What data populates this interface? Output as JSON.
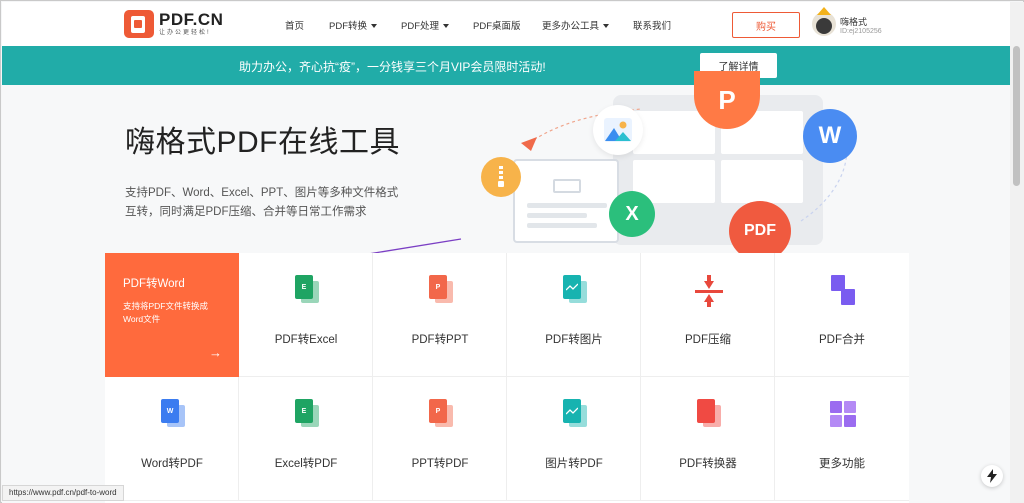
{
  "header": {
    "logo_name": "PDF.CN",
    "logo_slogan": "让办公更轻松!",
    "nav": [
      {
        "label": "首页"
      },
      {
        "label": "PDF转换"
      },
      {
        "label": "PDF处理"
      },
      {
        "label": "PDF桌面版"
      },
      {
        "label": "更多办公工具"
      },
      {
        "label": "联系我们"
      }
    ],
    "buy_label": "购买",
    "user_name": "嗨格式",
    "user_id": "ID:ej2105256"
  },
  "banner": {
    "text": "助力办公，齐心抗“疫”，一分钱享三个月VIP会员限时活动!",
    "button": "了解详情"
  },
  "hero": {
    "title": "嗨格式PDF在线工具",
    "desc_line1": "支持PDF、Word、Excel、PPT、图片等多种文件格式",
    "desc_line2": "互转，同时满足PDF压缩、合并等日常工作需求",
    "badges": {
      "p": "P",
      "w": "W",
      "x": "X",
      "pdf": "PDF"
    }
  },
  "tools": {
    "featured": {
      "title": "PDF转Word",
      "desc": "支持将PDF文件转换成Word文件",
      "arrow": "→"
    },
    "row1": [
      {
        "label": "PDF转Excel",
        "icon": "excel-doc-icon",
        "color": "#1fa463",
        "glyph": "E"
      },
      {
        "label": "PDF转PPT",
        "icon": "ppt-doc-icon",
        "color": "#f2674a",
        "glyph": "P"
      },
      {
        "label": "PDF转图片",
        "icon": "image-doc-icon",
        "color": "#17b3b0",
        "glyph": ""
      },
      {
        "label": "PDF压缩",
        "icon": "compress-icon",
        "color": "#e8483c",
        "glyph": ""
      },
      {
        "label": "PDF合并",
        "icon": "merge-icon",
        "color": "#7a5cf0",
        "glyph": ""
      }
    ],
    "row2": [
      {
        "label": "Word转PDF",
        "icon": "word-doc-icon",
        "color": "#3b7cf0",
        "glyph": "W"
      },
      {
        "label": "Excel转PDF",
        "icon": "excel-doc-icon",
        "color": "#1fa463",
        "glyph": "E"
      },
      {
        "label": "PPT转PDF",
        "icon": "ppt-doc-icon",
        "color": "#f2674a",
        "glyph": "P"
      },
      {
        "label": "图片转PDF",
        "icon": "image-doc-icon",
        "color": "#17b3b0",
        "glyph": ""
      },
      {
        "label": "PDF转换器",
        "icon": "converter-icon",
        "color": "#f04a43",
        "glyph": ""
      },
      {
        "label": "更多功能",
        "icon": "grid-icon",
        "color": "#9b6cf0",
        "glyph": ""
      }
    ]
  },
  "status_bar": {
    "url": "https://www.pdf.cn/pdf-to-word"
  },
  "colors": {
    "brand": "#ee5a36",
    "banner": "#21aca8",
    "featured_tile": "#ff6a3d"
  }
}
